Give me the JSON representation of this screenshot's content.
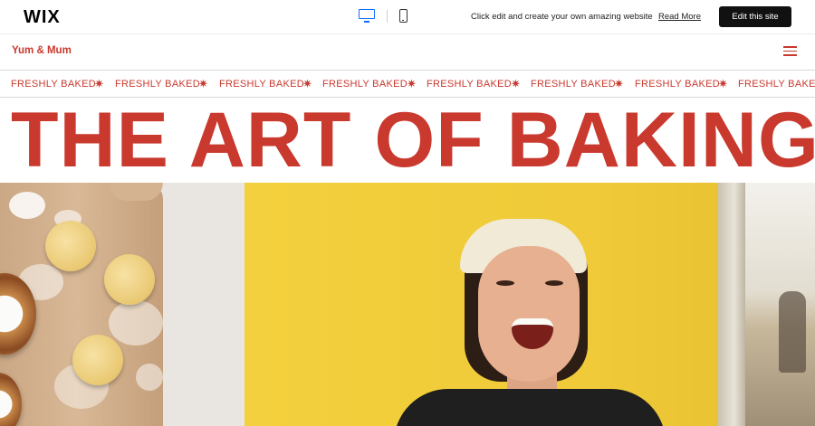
{
  "wix_bar": {
    "logo": "WIX",
    "promo_text": "Click edit and create your own amazing website",
    "read_more": "Read More",
    "edit_button": "Edit this site"
  },
  "site": {
    "brand": "Yum & Mum",
    "marquee": {
      "items": [
        "FRESHLY BAKED",
        "FRESHLY BAKED",
        "FRESHLY BAKED",
        "FRESHLY BAKED",
        "FRESHLY BAKED",
        "FRESHLY BAKED",
        "FRESHLY BAKED",
        "FRESHLY BAKED"
      ],
      "separator": "✷"
    },
    "headline": "THE ART OF BAKING"
  },
  "colors": {
    "brand_red": "#c9392e",
    "wix_blue": "#116dff",
    "hero_yellow": "#f1cc3b"
  },
  "icons": {
    "desktop": "desktop-icon",
    "mobile": "mobile-icon",
    "menu": "hamburger-menu-icon"
  }
}
